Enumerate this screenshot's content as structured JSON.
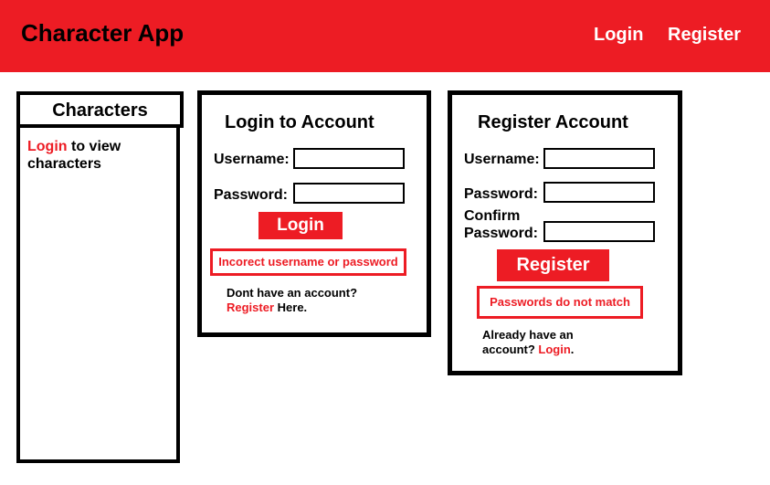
{
  "header": {
    "app_title": "Character App",
    "nav": {
      "login": "Login",
      "register": "Register"
    }
  },
  "colors": {
    "brand_red": "#ed1c24",
    "border": "#000000",
    "text_on_brand": "#ffffff"
  },
  "sidebar": {
    "title": "Characters",
    "login_link": "Login",
    "message_suffix": " to view characters"
  },
  "login_form": {
    "title": "Login to Account",
    "username_label": "Username:",
    "username_value": "",
    "password_label": "Password:",
    "password_value": "",
    "submit_label": "Login",
    "error": "Incorect username or password",
    "footer_prefix": "Dont have an account?",
    "footer_link": "Register",
    "footer_suffix": " Here."
  },
  "register_form": {
    "title": "Register Account",
    "username_label": "Username:",
    "username_value": "",
    "password_label": "Password:",
    "password_value": "",
    "confirm_label_line1": "Confirm",
    "confirm_label_line2": "Password:",
    "confirm_value": "",
    "submit_label": "Register",
    "error": "Passwords do not match",
    "footer_line1": "Already have an",
    "footer_prefix": "account? ",
    "footer_link": "Login",
    "footer_suffix": "."
  }
}
